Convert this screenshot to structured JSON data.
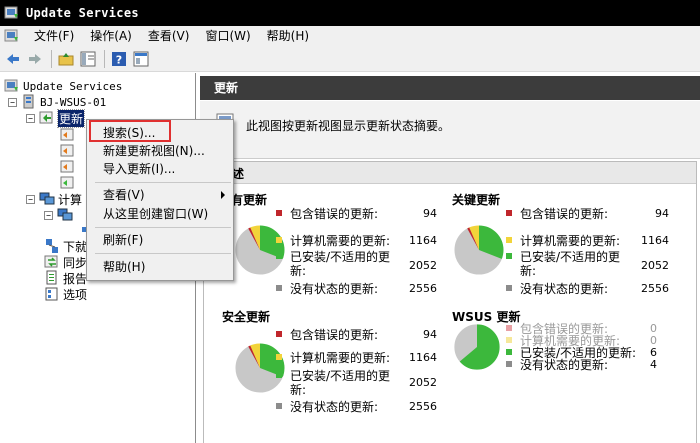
{
  "window": {
    "title": "Update Services"
  },
  "menubar": {
    "items": [
      "文件(F)",
      "操作(A)",
      "查看(V)",
      "窗口(W)",
      "帮助(H)"
    ]
  },
  "toolbar": {
    "buttons": [
      "back-icon",
      "forward-icon",
      "up-folder-icon",
      "show-hide-tree-icon",
      "help-icon",
      "properties-icon"
    ]
  },
  "tree": {
    "root": "Update Services",
    "server": "BJ-WSUS-01",
    "updates": "更新",
    "computers_partial": "计算",
    "downloads_partial": "下就",
    "sync_partial": "同步",
    "reports_partial": "报告",
    "options": "选项"
  },
  "context_menu": {
    "items": [
      "搜索(S)...",
      "新建更新视图(N)...",
      "导入更新(I)...",
      "查看(V)",
      "从这里创建窗口(W)",
      "刷新(F)",
      "帮助(H)"
    ]
  },
  "right_pane": {
    "header": "更新",
    "description": "此视图按更新视图显示更新状态摘要。",
    "overview_partial": "述"
  },
  "stat_labels": {
    "errors": "包含错误的更新:",
    "needed": "计算机需要的更新:",
    "installed_line1": "已安装/不适用的更",
    "installed_line2": "新:",
    "installed_single": "已安装/不适用的更新:",
    "no_status": "没有状态的更新:"
  },
  "blocks": [
    {
      "title": "有更新",
      "values": [
        "94",
        "1164",
        "2052",
        "2556"
      ]
    },
    {
      "title": "关键更新",
      "values": [
        "94",
        "1164",
        "2052",
        "2556"
      ]
    },
    {
      "title": "安全更新",
      "values": [
        "94",
        "1164",
        "2052",
        "2556"
      ]
    },
    {
      "title": "WSUS 更新",
      "values": [
        "0",
        "0",
        "6",
        "4"
      ]
    }
  ],
  "colors": {
    "errors": "#c0262b",
    "needed": "#f2d43a",
    "installed": "#3cb83c",
    "no_status": "#8c8c8c",
    "pie_gray": "#c8c8c8"
  }
}
